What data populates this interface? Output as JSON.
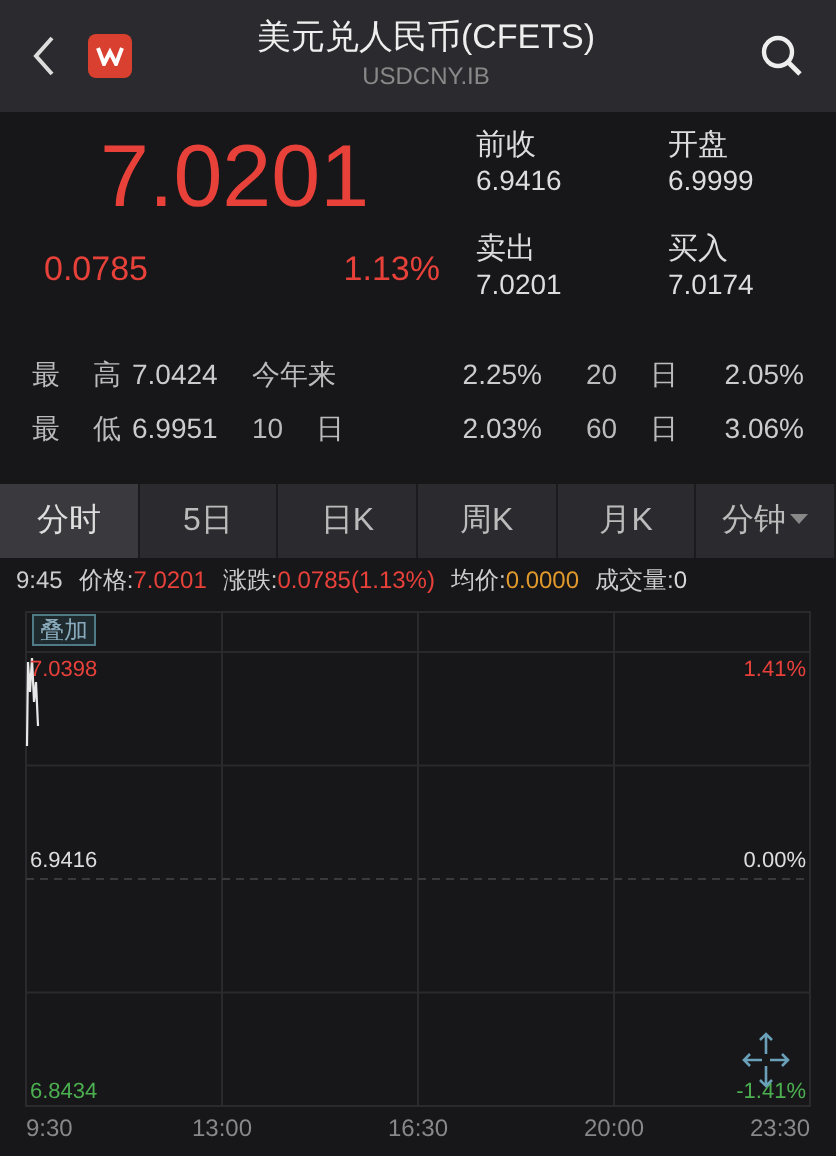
{
  "header": {
    "title": "美元兑人民币(CFETS)",
    "subtitle": "USDCNY.IB"
  },
  "quote": {
    "price": "7.0201",
    "change": "0.0785",
    "change_pct": "1.13%",
    "fields": [
      {
        "label": "前收",
        "value": "6.9416"
      },
      {
        "label": "开盘",
        "value": "6.9999"
      },
      {
        "label": "卖出",
        "value": "7.0201"
      },
      {
        "label": "买入",
        "value": "7.0174"
      }
    ]
  },
  "stats": [
    [
      {
        "label": "最 高",
        "value": "7.0424"
      },
      {
        "label": "今年来",
        "value": "2.25%"
      },
      {
        "label": "20 日",
        "value": "2.05%"
      }
    ],
    [
      {
        "label": "最 低",
        "value": "6.9951"
      },
      {
        "label": "10 日",
        "value": "2.03%"
      },
      {
        "label": "60 日",
        "value": "3.06%"
      }
    ]
  ],
  "tabs": [
    {
      "label": "分时",
      "selected": true,
      "kind": "tab"
    },
    {
      "label": "5日",
      "selected": false,
      "kind": "tab"
    },
    {
      "label": "日K",
      "selected": false,
      "kind": "tab"
    },
    {
      "label": "周K",
      "selected": false,
      "kind": "tab"
    },
    {
      "label": "月K",
      "selected": false,
      "kind": "tab"
    },
    {
      "label": "分钟",
      "selected": false,
      "kind": "dropdown"
    }
  ],
  "info": {
    "time": "9:45",
    "items": [
      {
        "label": "价格:",
        "value": "7.0201",
        "color": "#e8413a"
      },
      {
        "label": "涨跌:",
        "value": "0.0785(1.13%)",
        "color": "#e8413a"
      },
      {
        "label": "均价:",
        "value": "0.0000",
        "color": "#e0992a"
      },
      {
        "label": "成交量:",
        "value": "0",
        "color": "#d8d8d8"
      }
    ]
  },
  "chart": {
    "overlay_button": "叠加",
    "left_labels": [
      {
        "text": "7.0398",
        "color": "#e8413a"
      },
      {
        "text": "6.9416",
        "color": "#dddddd"
      },
      {
        "text": "6.8434",
        "color": "#4caf50"
      }
    ],
    "right_labels": [
      {
        "text": "1.41%",
        "color": "#e8413a"
      },
      {
        "text": "0.00%",
        "color": "#dddddd"
      },
      {
        "text": "-1.41%",
        "color": "#4caf50"
      }
    ],
    "time_labels": [
      "9:30",
      "13:00",
      "16:30",
      "20:00",
      "23:30"
    ]
  }
}
